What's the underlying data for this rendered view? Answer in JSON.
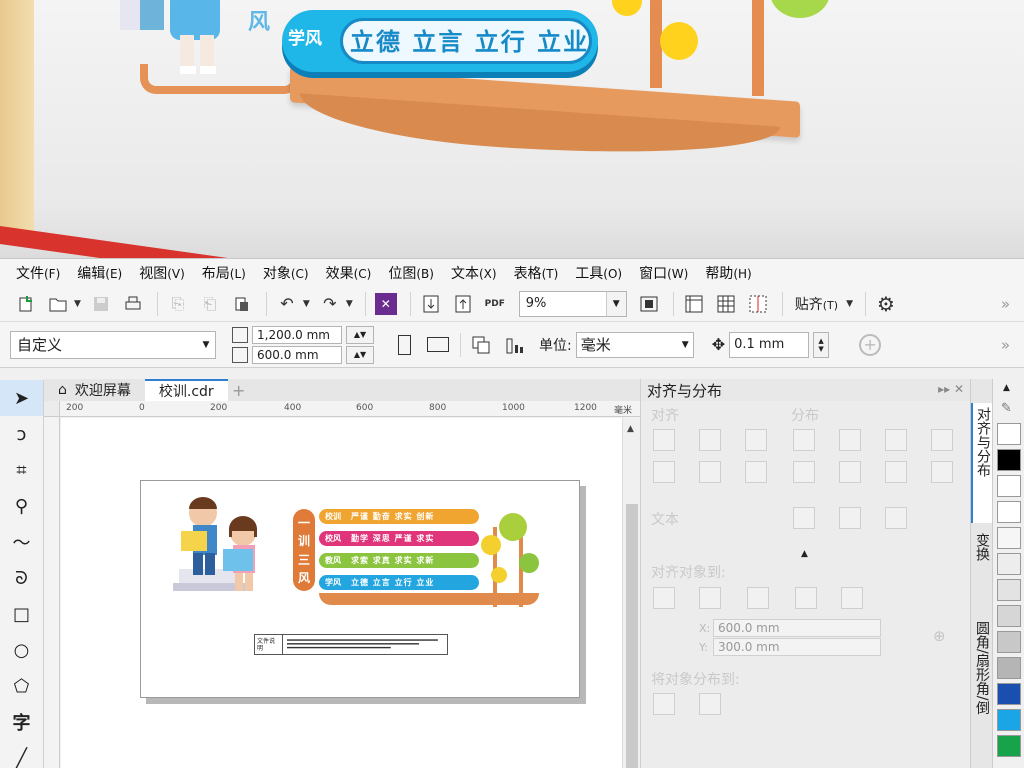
{
  "photo": {
    "pill_tag": "学风",
    "pill_text": "立德 立言 立行 立业",
    "side_char": "风"
  },
  "menu": [
    {
      "label": "文件",
      "acc": "(F)"
    },
    {
      "label": "编辑",
      "acc": "(E)"
    },
    {
      "label": "视图",
      "acc": "(V)"
    },
    {
      "label": "布局",
      "acc": "(L)"
    },
    {
      "label": "对象",
      "acc": "(C)"
    },
    {
      "label": "效果",
      "acc": "(C)"
    },
    {
      "label": "位图",
      "acc": "(B)"
    },
    {
      "label": "文本",
      "acc": "(X)"
    },
    {
      "label": "表格",
      "acc": "(T)"
    },
    {
      "label": "工具",
      "acc": "(O)"
    },
    {
      "label": "窗口",
      "acc": "(W)"
    },
    {
      "label": "帮助",
      "acc": "(H)"
    }
  ],
  "toolbar": {
    "zoom": "9%",
    "snap_label": "贴齐",
    "snap_acc": "(T)",
    "pdf_label": "PDF"
  },
  "propbar": {
    "preset": "自定义",
    "width": "1,200.0 mm",
    "height": "600.0 mm",
    "unit_label": "单位:",
    "unit_value": "毫米",
    "nudge": "0.1 mm"
  },
  "tabs": {
    "home": "欢迎屏幕",
    "file": "校训.cdr"
  },
  "ruler": {
    "ticks": [
      "200",
      "0",
      "200",
      "400",
      "600",
      "800",
      "1000",
      "1200"
    ],
    "unit": "毫米"
  },
  "design": {
    "vertical": [
      "一",
      "训",
      "三",
      "风"
    ],
    "rows": [
      {
        "tag": "校训",
        "text": "严谨 勤奋 求实 创新",
        "color": "#f0a531"
      },
      {
        "tag": "校风",
        "text": "勤学 深思 严谨 求实",
        "color": "#e0357a"
      },
      {
        "tag": "教风",
        "text": "求索 求真 求实 求新",
        "color": "#8bc43f"
      },
      {
        "tag": "学风",
        "text": "立德 立言 立行 立业",
        "color": "#23a6e0"
      }
    ],
    "caption_label": "文件说明"
  },
  "docker": {
    "title": "对齐与分布",
    "align_label": "对齐",
    "distribute_label": "分布",
    "text_label": "文本",
    "align_to_label": "对齐对象到:",
    "x_label": "X:",
    "x_value": "600.0 mm",
    "y_label": "Y:",
    "y_value": "300.0 mm",
    "dist_to_label": "将对象分布到:"
  },
  "vtabs": [
    "对齐与分布",
    "变换",
    "圆角/扇形角/倒"
  ],
  "palette": [
    "#ffffff",
    "#000000",
    "#ffffff",
    "#ffffff",
    "#f6f6f6",
    "#ededed",
    "#e3e3e3",
    "#d6d6d6",
    "#c8c8c8",
    "#b5b5b5",
    "#1a4fb0",
    "#1aa5e6",
    "#16a34a"
  ]
}
